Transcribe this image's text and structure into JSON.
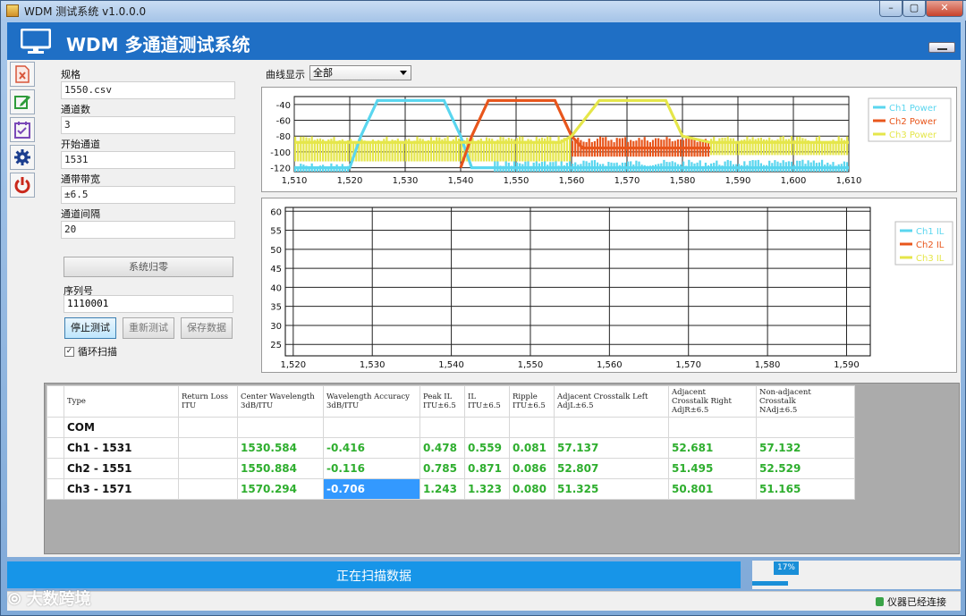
{
  "window": {
    "title": "WDM 测试系统 v1.0.0.0"
  },
  "app": {
    "title": "WDM 多通道测试系统"
  },
  "toolbar": {
    "items": [
      {
        "name": "excel-icon",
        "color": "#d8553a"
      },
      {
        "name": "edit-icon",
        "color": "#2e9b3a"
      },
      {
        "name": "calendar-check-icon",
        "color": "#7b4ab8"
      },
      {
        "name": "gear-icon",
        "color": "#1b3e8f"
      },
      {
        "name": "power-icon",
        "color": "#c9291c"
      }
    ]
  },
  "form": {
    "spec_label": "规格",
    "spec_value": "1550.csv",
    "channels_label": "通道数",
    "channels_value": "3",
    "start_label": "开始通道",
    "start_value": "1531",
    "bandwidth_label": "通带带宽",
    "bandwidth_value": "±6.5",
    "spacing_label": "通道间隔",
    "spacing_value": "20",
    "zero_button": "系统归零",
    "serial_label": "序列号",
    "serial_value": "1110001",
    "stop_button": "停止测试",
    "retest_button": "重新测试",
    "save_button": "保存数据",
    "loop_label": "循环扫描",
    "loop_checked": true
  },
  "curve": {
    "label": "曲线显示",
    "selected": "全部"
  },
  "power_chart": {
    "x_ticks": [
      "1,510",
      "1,520",
      "1,530",
      "1,540",
      "1,550",
      "1,560",
      "1,570",
      "1,580",
      "1,590",
      "1,600",
      "1,610"
    ],
    "y_ticks": [
      "-40",
      "-60",
      "-80",
      "-100",
      "-120"
    ],
    "legend": [
      "Ch1 Power",
      "Ch2 Power",
      "Ch3 Power"
    ]
  },
  "il_chart": {
    "x_ticks": [
      "1,520",
      "1,530",
      "1,540",
      "1,550",
      "1,560",
      "1,570",
      "1,580",
      "1,590"
    ],
    "y_ticks": [
      "60",
      "55",
      "50",
      "45",
      "40",
      "35",
      "30",
      "25"
    ],
    "legend": [
      "Ch1 IL",
      "Ch2 IL",
      "Ch3 IL"
    ]
  },
  "chart_data": [
    {
      "type": "line",
      "xlim": [
        1510,
        1610
      ],
      "ylim": [
        -125,
        -30
      ],
      "series": [
        {
          "name": "Ch1 Power",
          "color": "#5ad6ef",
          "x": [
            1510,
            1520,
            1522,
            1525,
            1537,
            1540,
            1542,
            1560,
            1610
          ],
          "y": [
            -120,
            -120,
            -80,
            -35,
            -35,
            -80,
            -120,
            -120,
            -120
          ]
        },
        {
          "name": "Ch2 Power",
          "color": "#e8561c",
          "x": [
            1540,
            1542,
            1545,
            1557,
            1560,
            1562,
            1585
          ],
          "y": [
            -120,
            -80,
            -35,
            -35,
            -80,
            -95,
            -95
          ]
        },
        {
          "name": "Ch3 Power",
          "color": "#e5e64a",
          "x": [
            1510,
            1558,
            1560,
            1565,
            1577,
            1580,
            1585,
            1610
          ],
          "y": [
            -88,
            -88,
            -80,
            -35,
            -35,
            -80,
            -88,
            -88
          ]
        }
      ]
    },
    {
      "type": "line",
      "xlim": [
        1519,
        1593
      ],
      "ylim": [
        22,
        61
      ],
      "series": [
        {
          "name": "Ch1 IL",
          "color": "#5ad6ef",
          "x": [],
          "y": []
        },
        {
          "name": "Ch2 IL",
          "color": "#e8561c",
          "x": [],
          "y": []
        },
        {
          "name": "Ch3 IL",
          "color": "#e5e64a",
          "x": [],
          "y": []
        }
      ]
    }
  ],
  "table": {
    "headers": [
      [
        "Type"
      ],
      [
        "Return Loss",
        "ITU"
      ],
      [
        "Center Wavelength",
        "3dB/ITU"
      ],
      [
        "Wavelength Accuracy",
        "3dB/ITU"
      ],
      [
        "Peak IL",
        "ITU±6.5"
      ],
      [
        "IL",
        "ITU±6.5"
      ],
      [
        "Ripple",
        "ITU±6.5"
      ],
      [
        "Adjacent Crosstalk Left",
        "AdjL±6.5"
      ],
      [
        "Adjacent",
        "Crosstalk Right",
        "AdjR±6.5"
      ],
      [
        "Non-adjacent",
        "Crosstalk",
        "NAdj±6.5"
      ]
    ],
    "rows": [
      [
        "COM",
        "",
        "",
        "",
        "",
        "",
        "",
        "",
        "",
        ""
      ],
      [
        "Ch1 - 1531",
        "",
        "1530.584",
        "-0.416",
        "0.478",
        "0.559",
        "0.081",
        "57.137",
        "52.681",
        "57.132"
      ],
      [
        "Ch2 - 1551",
        "",
        "1550.884",
        "-0.116",
        "0.785",
        "0.871",
        "0.086",
        "52.807",
        "51.495",
        "52.529"
      ],
      [
        "Ch3 - 1571",
        "",
        "1570.294",
        "-0.706",
        "1.243",
        "1.323",
        "0.080",
        "51.325",
        "50.801",
        "51.165"
      ]
    ],
    "selected_cell": [
      3,
      3
    ]
  },
  "status": {
    "message": "正在扫描数据",
    "progress_text": "17%",
    "progress": 0.17,
    "connection": "仪器已经连接"
  },
  "watermark": "大数跨境"
}
